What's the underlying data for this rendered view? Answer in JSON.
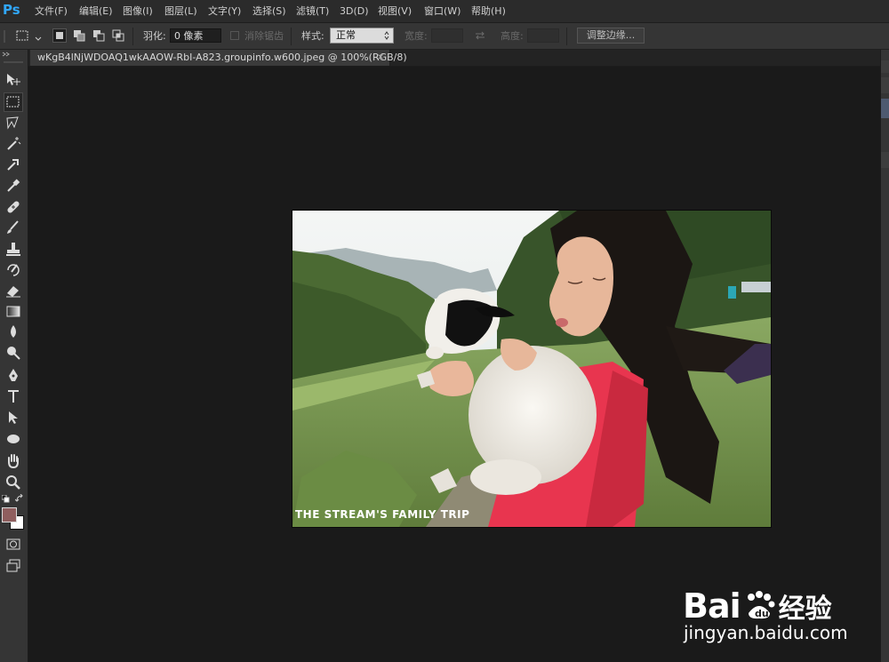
{
  "app": {
    "logo": "Ps"
  },
  "menu": {
    "items": [
      {
        "label": "文件(F)"
      },
      {
        "label": "编辑(E)"
      },
      {
        "label": "图像(I)"
      },
      {
        "label": "图层(L)"
      },
      {
        "label": "文字(Y)"
      },
      {
        "label": "选择(S)"
      },
      {
        "label": "滤镜(T)"
      },
      {
        "label": "3D(D)"
      },
      {
        "label": "视图(V)"
      },
      {
        "label": "窗口(W)"
      },
      {
        "label": "帮助(H)"
      }
    ]
  },
  "options": {
    "feather_label": "羽化:",
    "feather_value": "0 像素",
    "antialias_label": "消除锯齿",
    "style_label": "样式:",
    "style_value": "正常",
    "width_label": "宽度:",
    "height_label": "高度:",
    "refine_edge_label": "调整边缘..."
  },
  "document": {
    "tab_title": "wKgB4lNjWDOAQ1wkAAOW-RbI-A823.groupinfo.w600.jpeg @ 100%(RGB/8)",
    "tab_close": "×",
    "photo_caption": "THE STREAM'S FAMILY TRIP"
  },
  "colors": {
    "foreground": "#8f5e5e",
    "background": "#ffffff",
    "accent": "#31a8ff"
  },
  "watermark": {
    "brand_text": "Bai",
    "brand_cn": "经验",
    "url": "jingyan.baidu.com"
  }
}
